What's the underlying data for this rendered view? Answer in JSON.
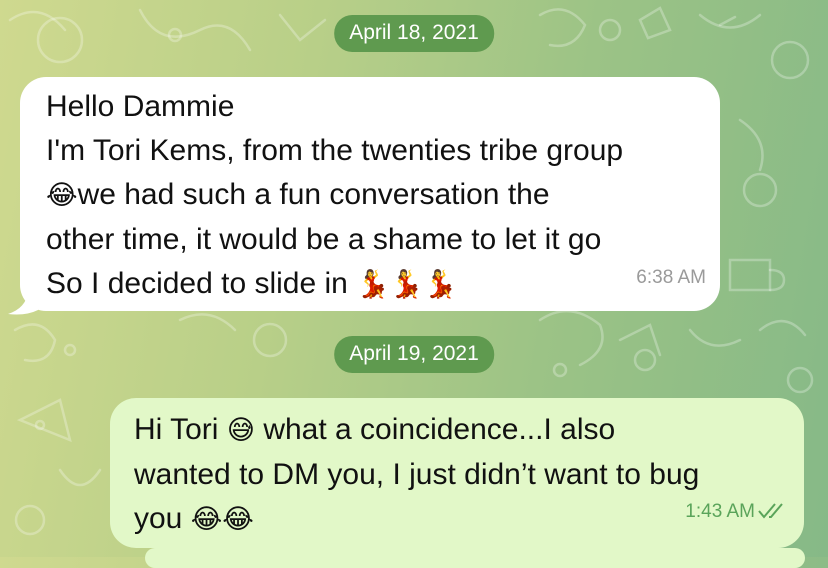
{
  "chat": {
    "dates": [
      "April 18, 2021",
      "April 19, 2021"
    ],
    "messages": [
      {
        "direction": "incoming",
        "lines": [
          "Hello Dammie",
          "I'm Tori Kems, from the twenties tribe group",
          "we had such a fun conversation the",
          "other time, it would be a shame to let it go",
          "So I decided to slide in"
        ],
        "emoji": {
          "laugh": "😂",
          "dancer": "💃"
        },
        "time": "6:38 AM"
      },
      {
        "direction": "outgoing",
        "parts": [
          "Hi Tori",
          "what a coincidence...I also",
          "wanted to DM you, I just didn’t want to bug",
          "you"
        ],
        "emoji": {
          "sweat_smile": "😅",
          "laugh": "😂"
        },
        "time": "1:43 AM",
        "status_icon": "double-check-icon",
        "status_color": "#5aa45a"
      }
    ]
  },
  "colors": {
    "date_pill": "#5f9a4f",
    "incoming_bubble": "#ffffff",
    "outgoing_bubble": "#e2f8c8"
  }
}
